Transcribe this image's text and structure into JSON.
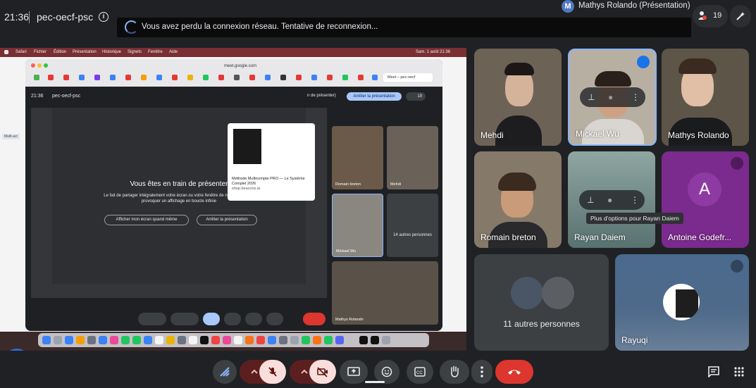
{
  "topbar": {
    "time": "21:36",
    "meeting_code": "pec-oecf-psc",
    "network_banner": "Vous avez perdu la connexion réseau. Tentative de reconnexion...",
    "presenter_initial": "M",
    "presenter_label": "Mathys Rolando (Présentation)",
    "people_count": "19"
  },
  "shared_screen": {
    "menubar": [
      "Safari",
      "Fichier",
      "Édition",
      "Présentation",
      "Historique",
      "Signets",
      "Fenêtre",
      "Aide"
    ],
    "menubar_clock": "Sam. 1 août 21:36",
    "left_tab": "Multi-act",
    "url": "meet.google.com",
    "inner_tab_label": "Meet – pec-oecf",
    "inner_time": "21:36",
    "inner_code": "pec-oecf-psc",
    "inner_presenting": "n de présenter)",
    "inner_stop_button": "Arrêter la présentation",
    "inner_people": "19",
    "overlay_title": "Vous êtes en train de présenter",
    "overlay_desc": "Le fait de partager intégralement votre écran ou votre fenêtre de navigateur peut provoquer un affichage en boucle infinie",
    "overlay_show_button": "Afficher mon écran quand même",
    "overlay_stop_button": "Arrêter la présentation",
    "tab_preview_title": "Méthode Multicompte PRO — Le Système Complet 2026",
    "tab_preview_site": "shop.beacons.ai",
    "inner_tiles": [
      "Romain breton",
      "Mehdi",
      "Mickael Wu",
      "14 autres personnes",
      "Mathys Rolando"
    ]
  },
  "tiles": {
    "mehdi": "Mehdi",
    "mickael": "Mickael Wu",
    "mathys": "Mathys Rolando",
    "romain": "Romain breton",
    "rayan": "Rayan Daiem",
    "antoine": "Antoine Godefr...",
    "antoine_initial": "A",
    "others": "11 autres personnes",
    "rayuqi": "Rayuqi"
  },
  "tooltip": "Plus d'options pour Rayan Daiem",
  "icons": [
    "info-icon",
    "people-icon",
    "host-controls-icon",
    "pin-icon",
    "mic-icon",
    "more-vert-icon",
    "mic-off-icon",
    "camera-off-icon",
    "present-icon",
    "emoji-icon",
    "captions-icon",
    "raise-hand-icon",
    "end-call-icon",
    "chat-icon",
    "apps-icon",
    "chevron-up-icon"
  ],
  "colors": {
    "background": "#202124",
    "accent_blue": "#8ab4f8",
    "end_call": "#dc362e",
    "muted_bg": "#f9dedc",
    "antoine_tile": "#7b2a8e"
  }
}
